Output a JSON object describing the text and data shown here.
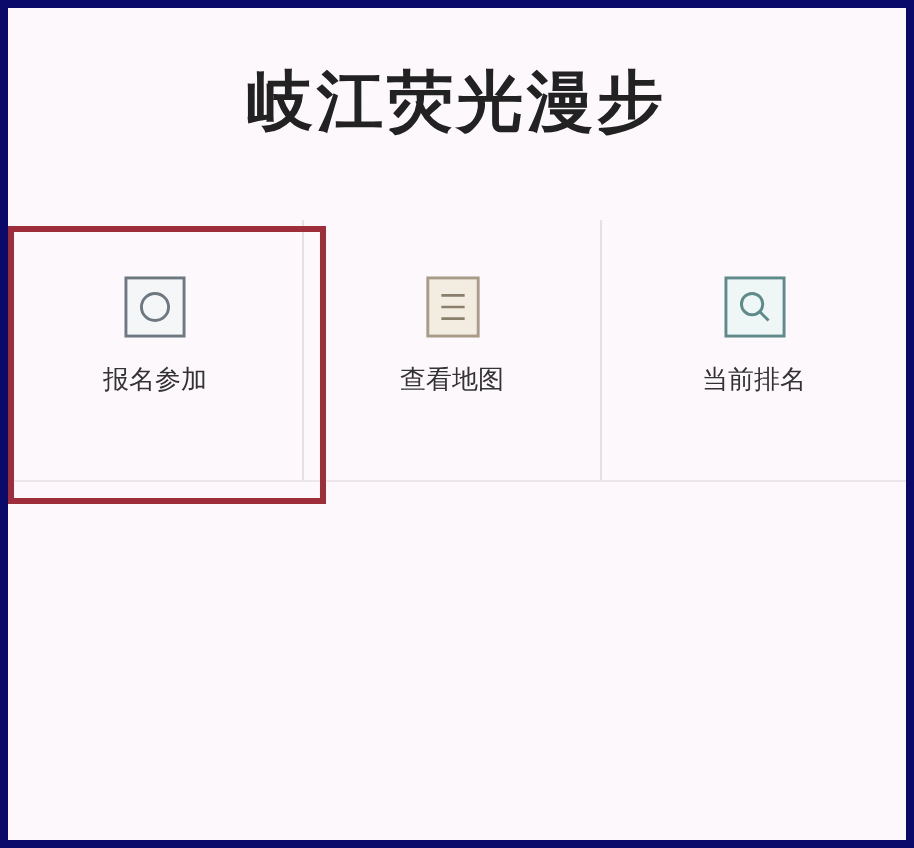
{
  "title": "岐江荧光漫步",
  "menu": [
    {
      "kind": "circle",
      "label": "报名参加",
      "selected": true
    },
    {
      "kind": "lines",
      "label": "查看地图",
      "selected": false
    },
    {
      "kind": "search",
      "label": "当前排名",
      "selected": false
    }
  ]
}
